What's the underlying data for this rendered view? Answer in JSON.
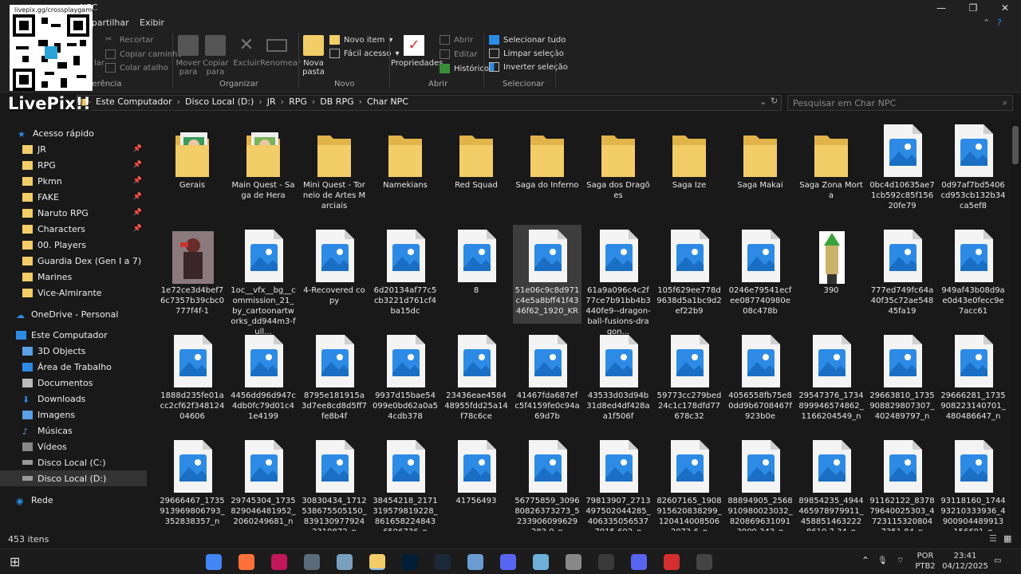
{
  "window": {
    "title": "NPC",
    "minimize": "—",
    "maximize": "❐",
    "close": "✕"
  },
  "menu_tabs": {
    "partial": "mpartilhar",
    "view": "Exibir"
  },
  "ribbon": {
    "clipboard": {
      "partial_label": "ferência",
      "partial_paste": "lar",
      "cut": "Recortar",
      "copy_path": "Copiar caminho",
      "paste_shortcut": "Colar atalho"
    },
    "organize": {
      "label": "Organizar",
      "move_to": "Mover para",
      "copy_to": "Copiar para",
      "delete": "Excluir",
      "rename": "Renomear"
    },
    "new": {
      "label": "Novo",
      "new_folder": "Nova pasta",
      "new_item": "Novo item",
      "easy_access": "Fácil acesso"
    },
    "open": {
      "label": "Abrir",
      "properties": "Propriedades",
      "open": "Abrir",
      "edit": "Editar",
      "history": "Histórico"
    },
    "select": {
      "label": "Selecionar",
      "select_all": "Selecionar tudo",
      "clear_selection": "Limpar seleção",
      "invert_selection": "Inverter seleção"
    }
  },
  "address": {
    "crumbs": [
      "Este Computador",
      "Disco Local (D:)",
      "JR",
      "RPG",
      "DB RPG",
      "Char NPC"
    ],
    "search_placeholder": "Pesquisar em Char NPC"
  },
  "sidebar": {
    "quick_access": "Acesso rápido",
    "pinned": [
      "JR",
      "RPG",
      "Pkmn",
      "FAKE",
      "Naruto RPG",
      "Characters"
    ],
    "folders": [
      "00. Players",
      "Guardia Dex (Gen I a 7)",
      "Marines",
      "Vice-Almirante"
    ],
    "onedrive": "OneDrive - Personal",
    "this_pc": "Este Computador",
    "pc_items": [
      "3D Objects",
      "Área de Trabalho",
      "Documentos",
      "Downloads",
      "Imagens",
      "Músicas",
      "Vídeos",
      "Disco Local (C:)",
      "Disco Local (D:)"
    ],
    "network": "Rede"
  },
  "files": [
    {
      "name": "Gerais",
      "kind": "folder-img"
    },
    {
      "name": "Main Quest - Saga de Hera",
      "kind": "folder-img"
    },
    {
      "name": "Mini Quest - Torneio de Artes Marciais",
      "kind": "folder"
    },
    {
      "name": "Namekians",
      "kind": "folder"
    },
    {
      "name": "Red Squad",
      "kind": "folder"
    },
    {
      "name": "Saga do Inferno",
      "kind": "folder"
    },
    {
      "name": "Saga dos Dragões",
      "kind": "folder"
    },
    {
      "name": "Saga Ize",
      "kind": "folder"
    },
    {
      "name": "Saga Makai",
      "kind": "folder"
    },
    {
      "name": "Saga Zona Morta",
      "kind": "folder"
    },
    {
      "name": "0bc4d10635ae71cb592c85f15620fe79",
      "kind": "image"
    },
    {
      "name": "0d97af7bd5406cd953cb132b34ca5ef8",
      "kind": "image"
    },
    {
      "name": "1e72ce3d4bef76c7357b39cbc0777f4f-1",
      "kind": "photo"
    },
    {
      "name": "1oc__vfx__bg__commission_21_by_cartoonartworks_dd944m3-full...",
      "kind": "image"
    },
    {
      "name": "4-Recovered copy",
      "kind": "image"
    },
    {
      "name": "6d20134af77c5cb3221d761cf4ba15dc",
      "kind": "image"
    },
    {
      "name": "8",
      "kind": "image"
    },
    {
      "name": "51e06c9c8d971c4e5a8bff41f4346f62_1920_KR",
      "kind": "image",
      "selected": true
    },
    {
      "name": "61a9a096c4c2f77ce7b91bb4b3440fe9--dragon-ball-fusions-dragon...",
      "kind": "image"
    },
    {
      "name": "105f629ee778d9638d5a1bc9d2ef22b9",
      "kind": "image"
    },
    {
      "name": "0246e79541ecfee087740980e08c478b",
      "kind": "image"
    },
    {
      "name": "390",
      "kind": "photo2"
    },
    {
      "name": "777ed749fc64a40f35c72ae54845fa19",
      "kind": "image"
    },
    {
      "name": "949af43b08d9ae0d43e0fecc9e7acc61",
      "kind": "image"
    },
    {
      "name": "1888d235fe01acc2cf62f34812404606",
      "kind": "image"
    },
    {
      "name": "4456dd96d947c4db0fc79d01c41e4199",
      "kind": "image"
    },
    {
      "name": "8795e181915a3d7ee8cd8d5ff7fe8b4f",
      "kind": "image"
    },
    {
      "name": "9937d15bae54099e0bd62a0a54cdb378",
      "kind": "image"
    },
    {
      "name": "23436eae458448955fdd25a14f78c6ce",
      "kind": "image"
    },
    {
      "name": "41467fda687efc5f4159fe0c94a69d7b",
      "kind": "image"
    },
    {
      "name": "43533d03d94b31d8ed4df428aa1f506f",
      "kind": "image"
    },
    {
      "name": "59773cc279bed24c1c178dfd77678c32",
      "kind": "image"
    },
    {
      "name": "4056558fb75e80dd9b6708467f923b0e",
      "kind": "image"
    },
    {
      "name": "29547376_1734899946574862_1166204549_n",
      "kind": "image"
    },
    {
      "name": "29663810_1735908829807307_402489797_n",
      "kind": "image"
    },
    {
      "name": "29666281_1735908223140701_480486647_n",
      "kind": "image"
    },
    {
      "name": "29666467_1735913969806793_352838357_n",
      "kind": "image"
    },
    {
      "name": "29745304_1735829046481952_2060249681_n",
      "kind": "image"
    },
    {
      "name": "30830434_1712538675505150_8391309779242319872_n",
      "kind": "image"
    },
    {
      "name": "38454218_2171319579819228_8616582248436596736_n",
      "kind": "image"
    },
    {
      "name": "41756493",
      "kind": "image"
    },
    {
      "name": "56775859_309680826373273_5233906099629283 9_n",
      "kind": "image"
    },
    {
      "name": "79813907_2713497502044285_4063350565377915 692_n",
      "kind": "image"
    },
    {
      "name": "82607165_1908915620838299_1204140085062073 6_n",
      "kind": "image"
    },
    {
      "name": "88894905_2568910980023032_8208696310913909 343_n",
      "kind": "image"
    },
    {
      "name": "89854235_4944465978979911_4588514632228610 7 34_n",
      "kind": "image"
    },
    {
      "name": "91162122_837879640025303_47231153208047351 84_n",
      "kind": "image"
    },
    {
      "name": "93118160_174493210333936_4900904489913156601_n",
      "kind": "image"
    }
  ],
  "status": {
    "count": "453 itens"
  },
  "taskbar": {
    "lang": "POR",
    "layout": "PTB2",
    "time": "23:41",
    "date": "04/12/2025",
    "apps": [
      "chrome",
      "firefox",
      "opera",
      "app",
      "app",
      "explorer",
      "photoshop",
      "steam",
      "app",
      "game",
      "app",
      "app",
      "app",
      "discord",
      "app",
      "obs"
    ]
  },
  "overlay": {
    "url": "livepix.gg/crossplaygames",
    "brand": "LivePix!!"
  },
  "colors": {
    "folder": "#F2CD68",
    "folder_dark": "#E1B44A",
    "image_blue": "#2D8BE6",
    "selection": "#3d3d3d"
  }
}
